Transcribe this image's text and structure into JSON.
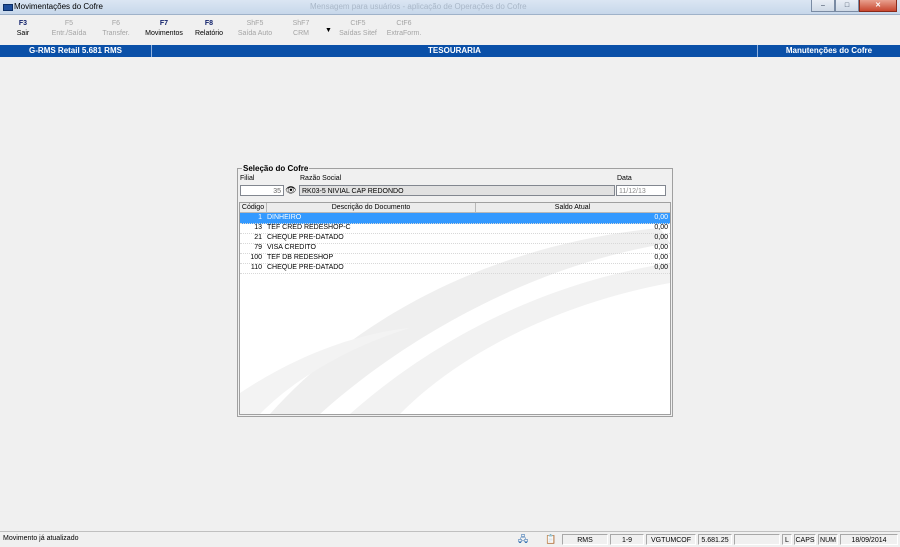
{
  "window": {
    "title": "Movimentações do Cofre",
    "ghost_title": "Mensagem para usuários - aplicação de Operações do Cofre",
    "buttons": {
      "minimize": "–",
      "maximize": "□",
      "close": "✕"
    }
  },
  "toolbar": [
    {
      "key": "F3",
      "label": "Sair",
      "enabled": true
    },
    {
      "key": "F5",
      "label": "Entr./Saída",
      "enabled": false
    },
    {
      "key": "F6",
      "label": "Transfer.",
      "enabled": false
    },
    {
      "key": "F7",
      "label": "Movimentos",
      "enabled": true
    },
    {
      "key": "F8",
      "label": "Relatório",
      "enabled": true
    },
    {
      "key": "ShF5",
      "label": "Saída Auto",
      "enabled": false
    },
    {
      "key": "ShF7",
      "label": "CRM",
      "enabled": false
    },
    {
      "key": "CtF5",
      "label": "Saídas Sitef",
      "enabled": false
    },
    {
      "key": "CtF6",
      "label": "ExtraForm.",
      "enabled": false
    }
  ],
  "header_band": {
    "left": "G-RMS Retail 5.681 RMS",
    "center": "TESOURARIA",
    "right": "Manutenções do Cofre"
  },
  "selection": {
    "legend": "Seleção do Cofre",
    "filial_label": "Filial",
    "filial_value": "35",
    "razao_label": "Razão Social",
    "razao_value": "RK03-5 NIVIAL CAP REDONDO",
    "data_label": "Data",
    "data_value": "11/12/13"
  },
  "table": {
    "columns": [
      "Código",
      "Descrição do Documento",
      "Saldo Atual"
    ],
    "rows": [
      {
        "codigo": "1",
        "descricao": "DINHEIRO",
        "saldo": "0,00",
        "selected": true
      },
      {
        "codigo": "13",
        "descricao": "TEF CRED REDESHOP-C",
        "saldo": "0,00",
        "selected": false
      },
      {
        "codigo": "21",
        "descricao": "CHEQUE PRE-DATADO",
        "saldo": "0,00",
        "selected": false
      },
      {
        "codigo": "79",
        "descricao": "VISA CREDITO",
        "saldo": "0,00",
        "selected": false
      },
      {
        "codigo": "100",
        "descricao": "TEF DB REDESHOP",
        "saldo": "0,00",
        "selected": false
      },
      {
        "codigo": "110",
        "descricao": "CHEQUE PRE-DATADO",
        "saldo": "0,00",
        "selected": false
      }
    ]
  },
  "statusbar": {
    "message": "Movimento já atualizado",
    "user": "RMS",
    "range": "1-9",
    "program": "VGTUMCOF",
    "version": "5.681.25",
    "blank": "",
    "l": "L",
    "caps": "CAPS",
    "num": "NUM",
    "date": "18/09/2014"
  }
}
